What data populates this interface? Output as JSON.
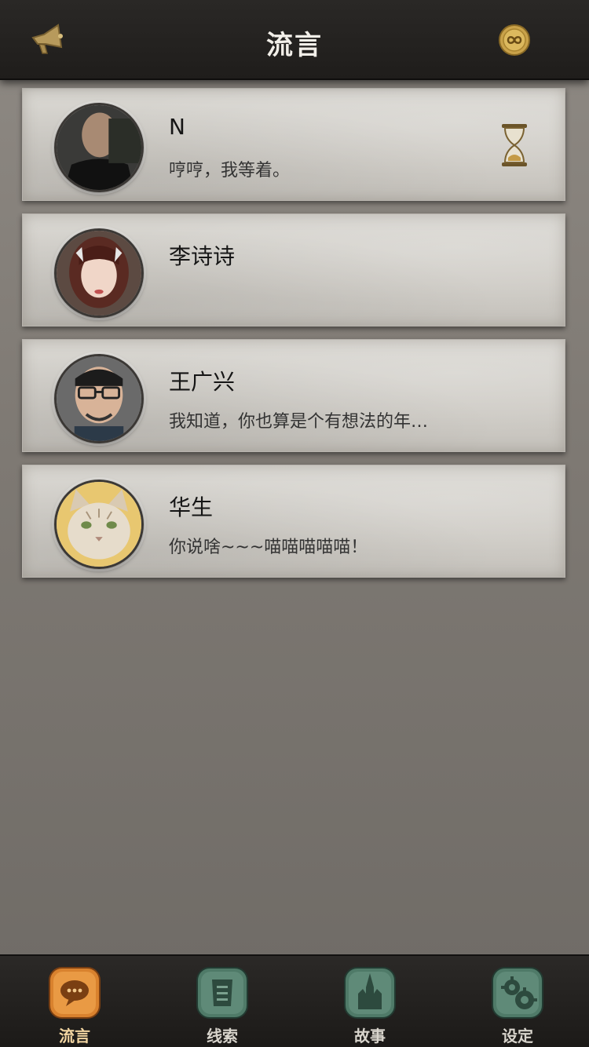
{
  "header": {
    "title": "流言",
    "left_icon": "megaphone-icon",
    "right_icon": "infinity-coin-icon"
  },
  "messages": [
    {
      "name": "N",
      "preview": "哼哼，我等着。",
      "status_icon": "hourglass-icon"
    },
    {
      "name": "李诗诗",
      "preview": ""
    },
    {
      "name": "王广兴",
      "preview": "我知道，你也算是个有想法的年…"
    },
    {
      "name": "华生",
      "preview": "你说啥~~~喵喵喵喵喵！"
    }
  ],
  "tabs": [
    {
      "label": "流言",
      "icon": "chat-bubble-icon",
      "active": true
    },
    {
      "label": "线索",
      "icon": "scroll-icon",
      "active": false
    },
    {
      "label": "故事",
      "icon": "cathedral-icon",
      "active": false
    },
    {
      "label": "设定",
      "icon": "gears-icon",
      "active": false
    }
  ],
  "colors": {
    "header_bg": "#211f1d",
    "card_bg": "#d3d0ca",
    "active_tab": "#e8963a",
    "inactive_tab": "#5f8a78"
  }
}
